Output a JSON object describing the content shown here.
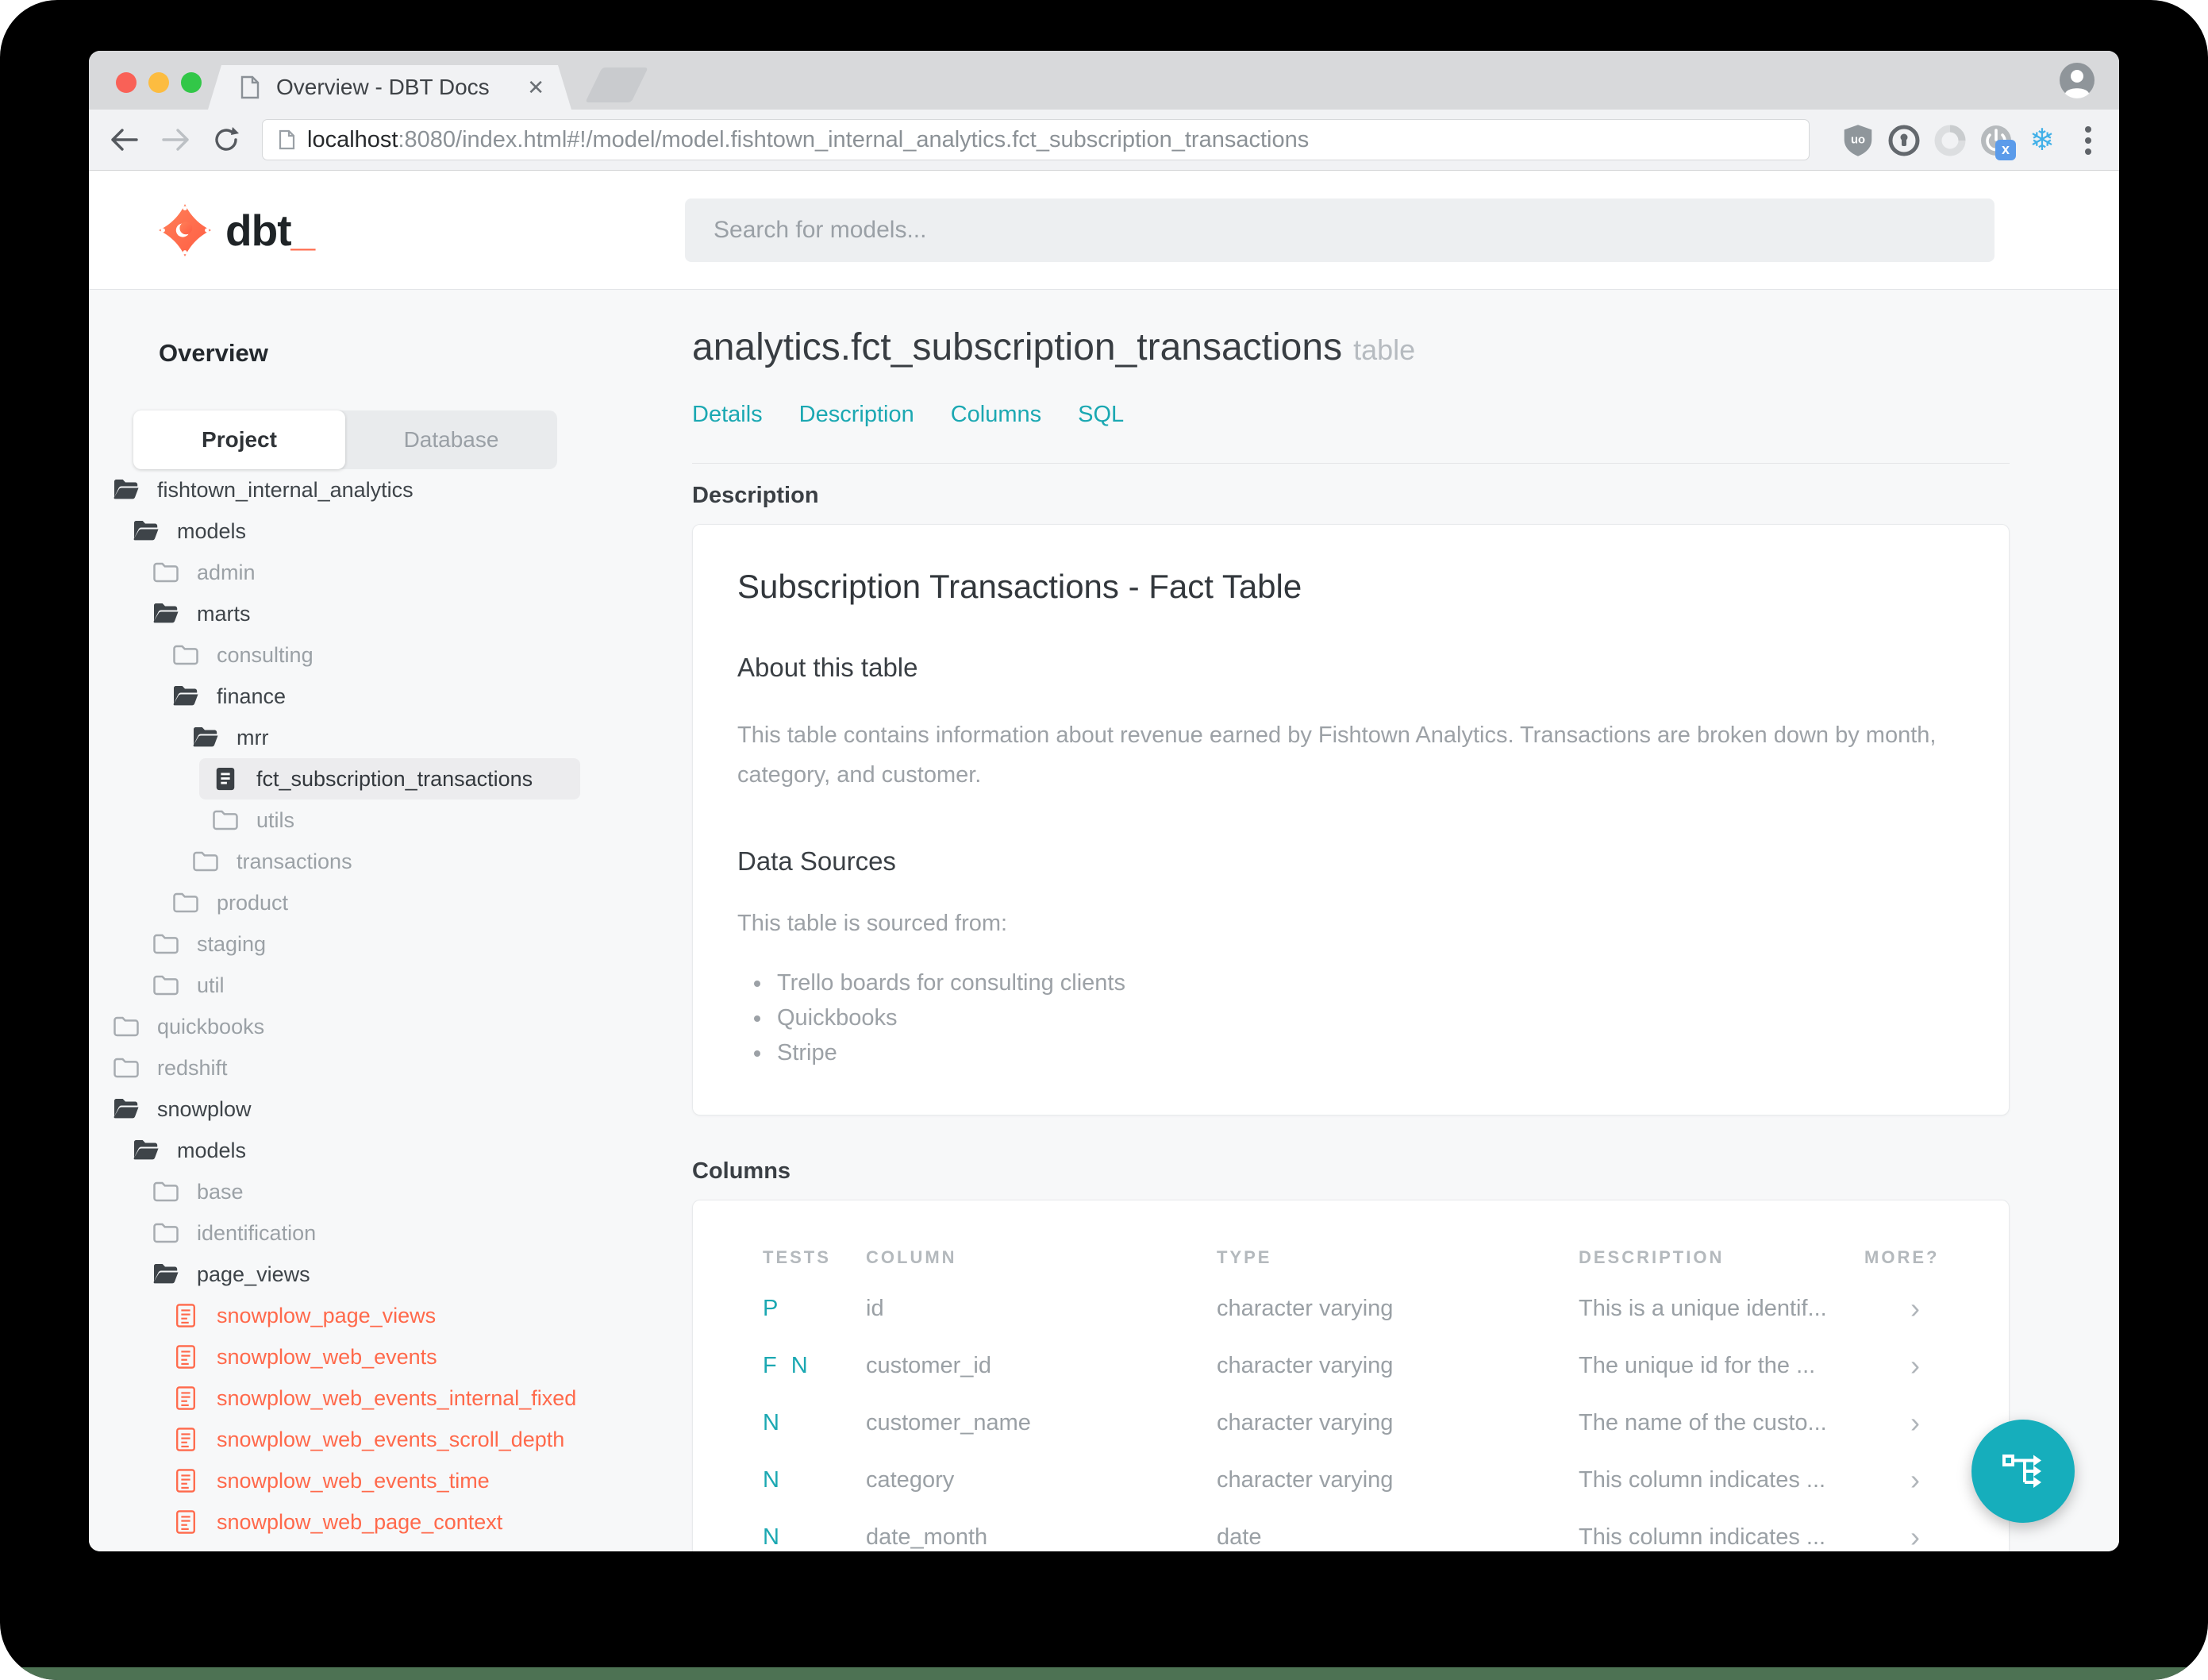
{
  "browser": {
    "tab": {
      "title": "Overview - DBT Docs",
      "close": "✕"
    },
    "url": {
      "host": "localhost",
      "rest": ":8080/index.html#!/model/model.fishtown_internal_analytics.fct_subscription_transactions"
    },
    "extension_icons": [
      "ublock-origin-shield",
      "onepassword-keyhole",
      "extension-disc",
      "power-toggle-x",
      "snowflake",
      "menu-dots"
    ],
    "snowflake_glyph": "❄",
    "power_badge": "x"
  },
  "appheader": {
    "logo_text": "dbt",
    "logo_cursor": "_",
    "search_placeholder": "Search for models..."
  },
  "sidebar": {
    "overview": "Overview",
    "toggle": {
      "project": "Project",
      "database": "Database"
    },
    "tree": [
      {
        "label": "fishtown_internal_analytics",
        "level": 0,
        "type": "folder-open",
        "tone": "dark"
      },
      {
        "label": "models",
        "level": 1,
        "type": "folder-open",
        "tone": "dark"
      },
      {
        "label": "admin",
        "level": 2,
        "type": "folder",
        "tone": "muted"
      },
      {
        "label": "marts",
        "level": 2,
        "type": "folder-open",
        "tone": "dark"
      },
      {
        "label": "consulting",
        "level": 3,
        "type": "folder",
        "tone": "muted"
      },
      {
        "label": "finance",
        "level": 3,
        "type": "folder-open",
        "tone": "dark"
      },
      {
        "label": "mrr",
        "level": 4,
        "type": "folder-open",
        "tone": "dark"
      },
      {
        "label": "fct_subscription_transactions",
        "level": 5,
        "type": "file",
        "tone": "selected"
      },
      {
        "label": "utils",
        "level": 5,
        "type": "folder",
        "tone": "muted"
      },
      {
        "label": "transactions",
        "level": 4,
        "type": "folder",
        "tone": "muted"
      },
      {
        "label": "product",
        "level": 3,
        "type": "folder",
        "tone": "muted"
      },
      {
        "label": "staging",
        "level": 2,
        "type": "folder",
        "tone": "muted"
      },
      {
        "label": "util",
        "level": 2,
        "type": "folder",
        "tone": "muted"
      },
      {
        "label": "quickbooks",
        "level": 0,
        "type": "folder",
        "tone": "muted"
      },
      {
        "label": "redshift",
        "level": 0,
        "type": "folder",
        "tone": "muted"
      },
      {
        "label": "snowplow",
        "level": 0,
        "type": "folder-open",
        "tone": "dark"
      },
      {
        "label": "models",
        "level": 1,
        "type": "folder-open",
        "tone": "dark"
      },
      {
        "label": "base",
        "level": 2,
        "type": "folder",
        "tone": "muted"
      },
      {
        "label": "identification",
        "level": 2,
        "type": "folder",
        "tone": "muted"
      },
      {
        "label": "page_views",
        "level": 2,
        "type": "folder-open",
        "tone": "dark"
      },
      {
        "label": "snowplow_page_views",
        "level": 3,
        "type": "file-lines",
        "tone": "error"
      },
      {
        "label": "snowplow_web_events",
        "level": 3,
        "type": "file-lines",
        "tone": "error"
      },
      {
        "label": "snowplow_web_events_internal_fixed",
        "level": 3,
        "type": "file-lines",
        "tone": "error"
      },
      {
        "label": "snowplow_web_events_scroll_depth",
        "level": 3,
        "type": "file-lines",
        "tone": "error"
      },
      {
        "label": "snowplow_web_events_time",
        "level": 3,
        "type": "file-lines",
        "tone": "error"
      },
      {
        "label": "snowplow_web_page_context",
        "level": 3,
        "type": "file-lines",
        "tone": "error"
      }
    ]
  },
  "main": {
    "title": "analytics.fct_subscription_transactions",
    "title_suffix": "table",
    "nav": [
      "Details",
      "Description",
      "Columns",
      "SQL"
    ],
    "description": {
      "section_heading": "Description",
      "card_title": "Subscription Transactions - Fact Table",
      "about_heading": "About this table",
      "about_body": "This table contains information about revenue earned by Fishtown Analytics. Transactions are broken down by month, category, and customer.",
      "sources_heading": "Data Sources",
      "sources_intro": "This table is sourced from:",
      "sources": [
        "Trello boards for consulting clients",
        "Quickbooks",
        "Stripe"
      ]
    },
    "columns": {
      "section_heading": "Columns",
      "headers": {
        "tests": "TESTS",
        "column": "COLUMN",
        "type": "TYPE",
        "description": "DESCRIPTION",
        "more": "MORE?"
      },
      "rows": [
        {
          "tests": "P",
          "column": "id",
          "type": "character varying",
          "description": "This is a unique identif...",
          "more": "›"
        },
        {
          "tests": "F N",
          "column": "customer_id",
          "type": "character varying",
          "description": "The unique id for the ...",
          "more": "›"
        },
        {
          "tests": "N",
          "column": "customer_name",
          "type": "character varying",
          "description": "The name of the custo...",
          "more": "›"
        },
        {
          "tests": "N",
          "column": "category",
          "type": "character varying",
          "description": "This column indicates ...",
          "more": "›"
        },
        {
          "tests": "N",
          "column": "date_month",
          "type": "date",
          "description": "This column indicates ...",
          "more": "›"
        }
      ]
    }
  },
  "fab": {
    "icon": "lineage-graph"
  },
  "colors": {
    "accent_teal": "#1ba8b2",
    "brand_orange": "#ff694b",
    "error_red": "#ff694b",
    "wallpaper_green": "#4d7253"
  }
}
